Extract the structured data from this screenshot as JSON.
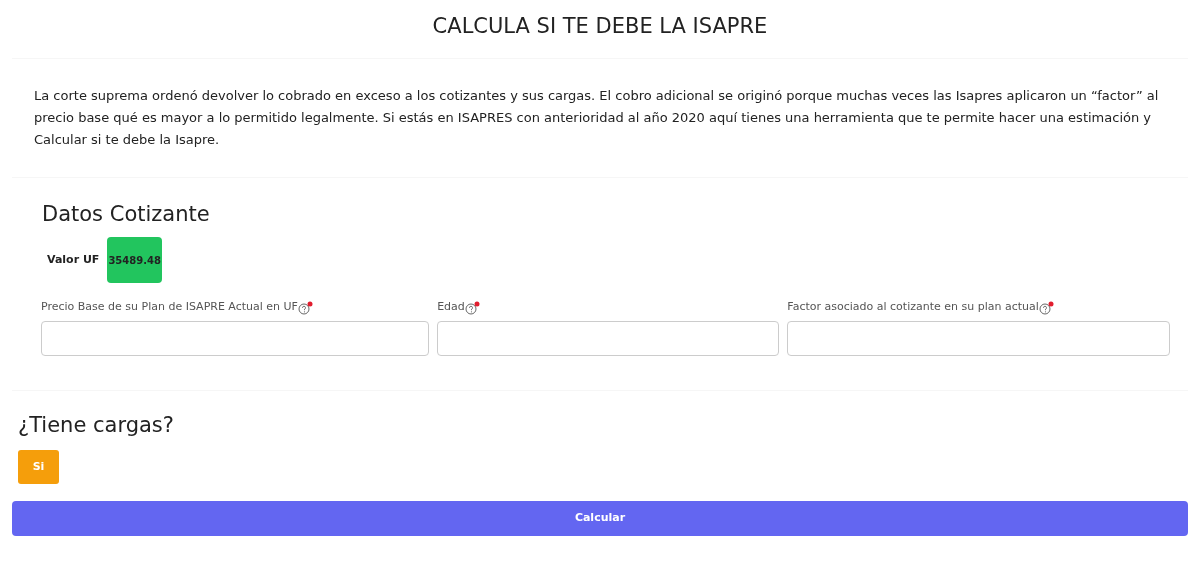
{
  "title": "CALCULA SI TE DEBE LA ISAPRE",
  "intro": "La corte suprema ordenó devolver lo cobrado en exceso a los cotizantes y sus cargas. El cobro adicional se originó porque muchas veces las Isapres aplicaron un “factor” al precio base qué es mayor a lo permitido legalmente. Si estás en ISAPRES con anterioridad al año 2020 aquí tienes una herramienta que te permite hacer una estimación y Calcular si te debe la Isapre.",
  "section": {
    "heading": "Datos Cotizante",
    "uf_label": "Valor UF",
    "uf_value": "35489.48",
    "fields": [
      {
        "label": "Precio Base de su Plan de ISAPRE Actual en UF"
      },
      {
        "label": "Edad"
      },
      {
        "label": "Factor asociado al cotizante en su plan actual"
      }
    ]
  },
  "cargas": {
    "heading": "¿Tiene cargas?",
    "button": "Si"
  },
  "submit": "Calcular"
}
